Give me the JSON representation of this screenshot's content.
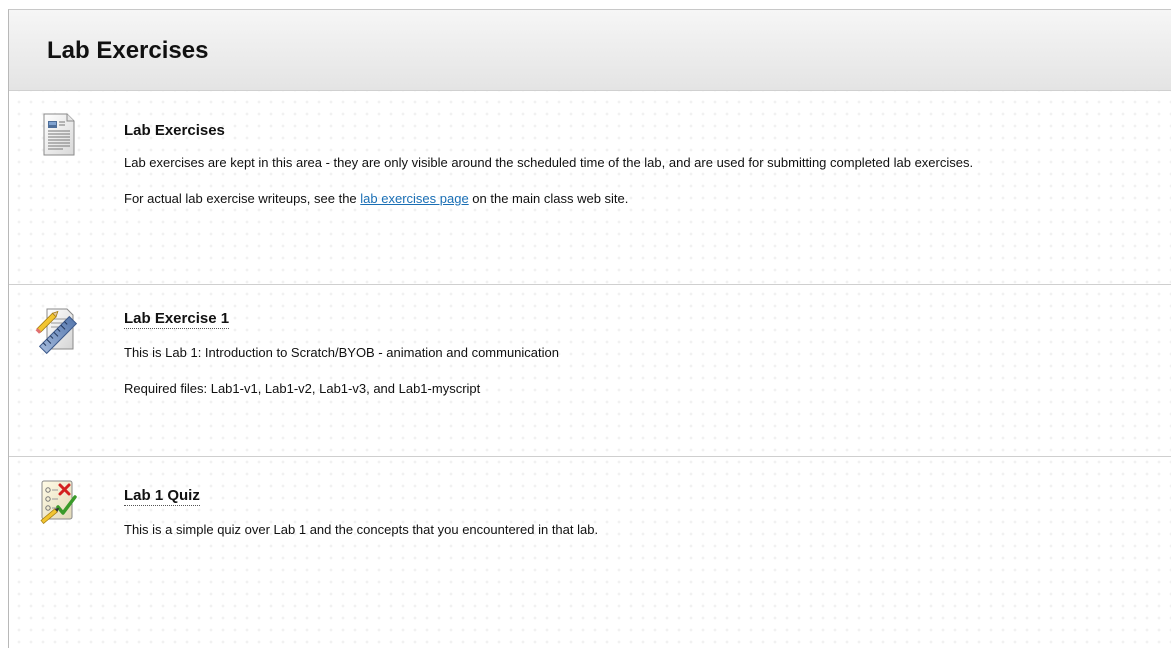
{
  "page": {
    "title": "Lab Exercises"
  },
  "items": [
    {
      "icon": "document-icon",
      "title": "Lab Exercises",
      "paragraphs": {
        "p1": "Lab exercises are kept in this area - they are only visible around the scheduled time of the lab, and are used for submitting completed lab exercises.",
        "p2_before": "For actual lab exercise writeups, see the ",
        "p2_link": "lab exercises page",
        "p2_after": " on the main class web site."
      }
    },
    {
      "icon": "assignment-icon",
      "title": "Lab Exercise 1",
      "description": "This is Lab 1: Introduction to Scratch/BYOB - animation and communication",
      "required_files": "Required files:  Lab1-v1, Lab1-v2, Lab1-v3, and Lab1-myscript"
    },
    {
      "icon": "quiz-icon",
      "title": "Lab 1 Quiz",
      "description": "This is a simple quiz over Lab 1 and the concepts that you encountered in that lab."
    }
  ]
}
